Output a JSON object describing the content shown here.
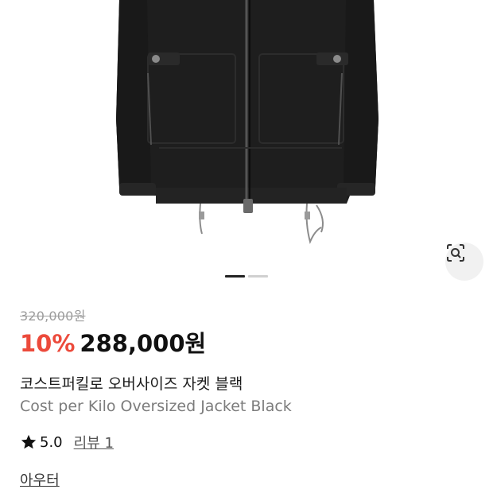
{
  "product": {
    "image_alt": "Cost per Kilo Oversized Jacket Black product photo",
    "original_price": "320,000원",
    "discount": "10%",
    "sale_price": "288,000원",
    "title_ko": "코스트퍼킬로 오버사이즈 자켓 블랙",
    "title_en": "Cost per Kilo Oversized Jacket Black",
    "rating": "5.0",
    "reviews_label": "리뷰 1",
    "category": "아우터"
  },
  "gallery": {
    "total_slides": 2,
    "active_slide": 1
  },
  "icons": {
    "lens": "lens-search-icon",
    "star": "star-icon"
  },
  "colors": {
    "discount": "#ec4a3b",
    "garment": "#1e1e1e"
  }
}
